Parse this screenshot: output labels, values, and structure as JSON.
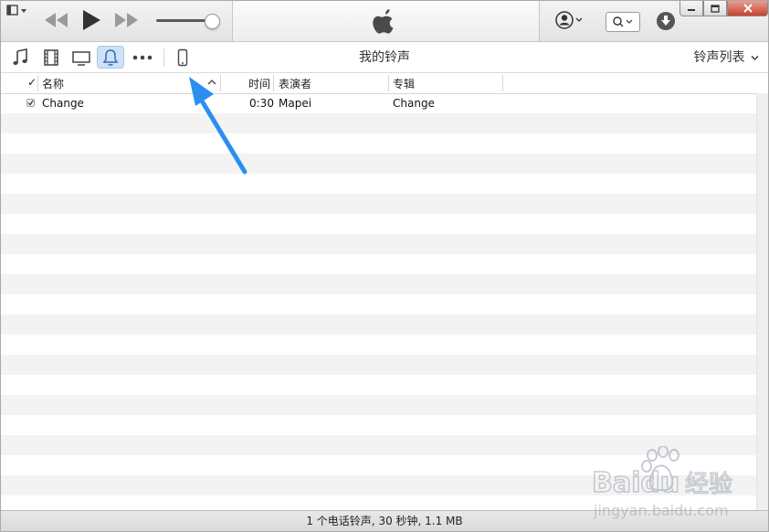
{
  "media_nav": {
    "page_title": "我的铃声",
    "view_selector": "铃声列表"
  },
  "table": {
    "columns": {
      "check": "✓",
      "name": "名称",
      "time": "时间",
      "artist": "表演者",
      "album": "专辑"
    },
    "rows": [
      {
        "name": "Change",
        "time": "0:30",
        "artist": "Mapei",
        "album": "Change"
      }
    ]
  },
  "status_bar": "1 个电话铃声, 30 秒钟, 1.1 MB",
  "watermark": {
    "brand": "Baidu",
    "suffix": "经验",
    "url": "jingyan.baidu.com"
  },
  "colors": {
    "accent_arrow": "#2b8ff0",
    "active_tab": "#cfe1f7",
    "close_button": "#c7432f"
  }
}
